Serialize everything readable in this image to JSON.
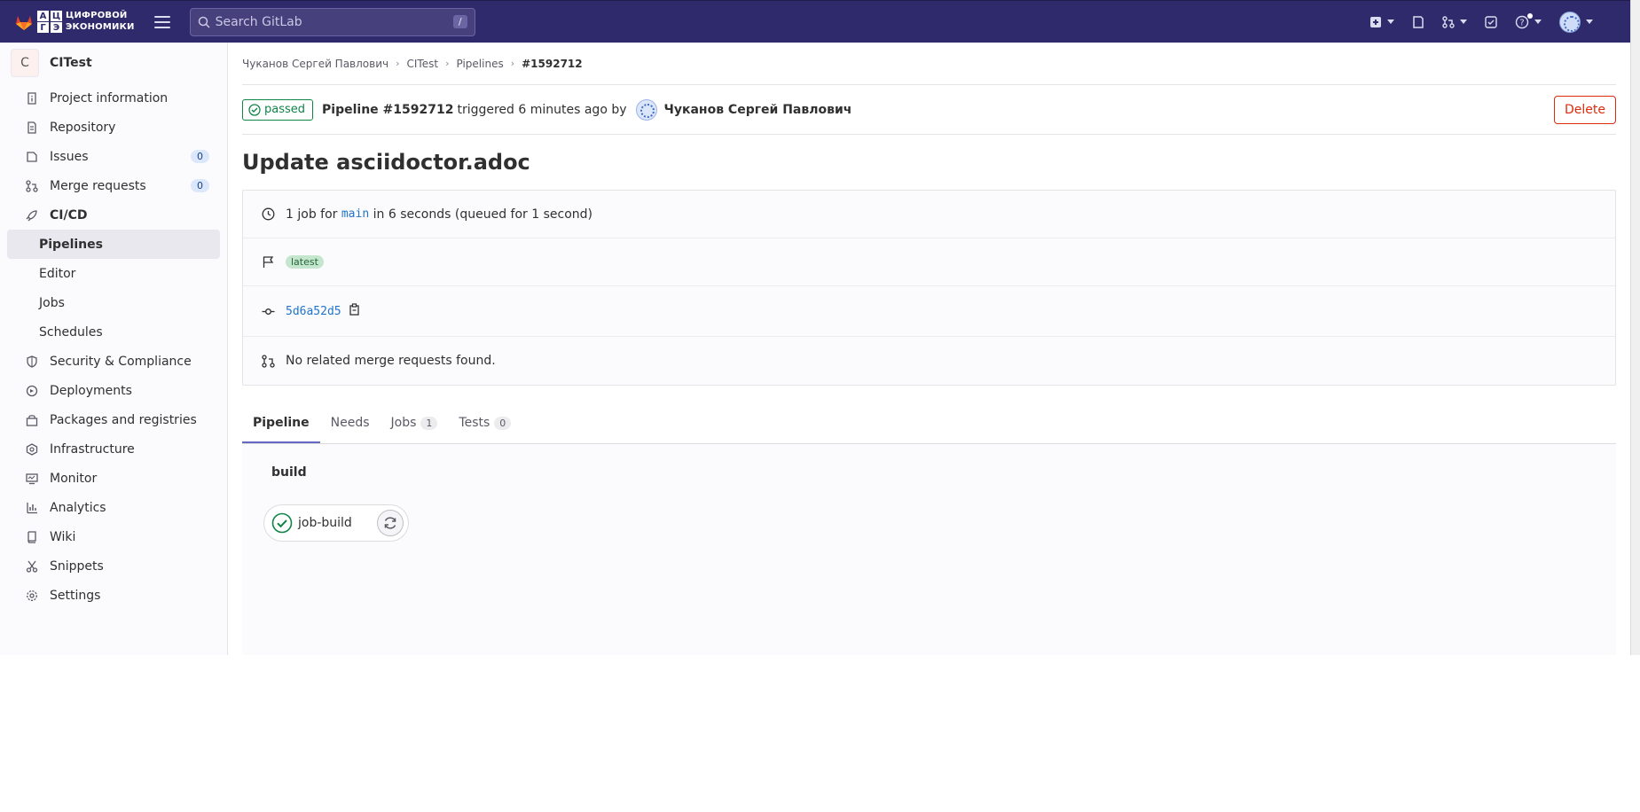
{
  "header": {
    "logo_letters": [
      "А",
      "Ц",
      "Г",
      "Э"
    ],
    "logo_line1": "ЦИФРОВОЙ",
    "logo_line2": "ЭКОНОМИКИ",
    "search_placeholder": "Search GitLab",
    "search_shortcut": "/",
    "icons": [
      "plus-square-icon",
      "issues-icon",
      "merge-request-icon",
      "todo-icon",
      "help-icon",
      "user-avatar"
    ]
  },
  "sidebar": {
    "project_initial": "C",
    "project_name": "CITest",
    "items": [
      {
        "label": "Project information",
        "icon": "info-icon"
      },
      {
        "label": "Repository",
        "icon": "doc-icon"
      },
      {
        "label": "Issues",
        "icon": "issues-icon",
        "count": "0"
      },
      {
        "label": "Merge requests",
        "icon": "merge-request-icon",
        "count": "0"
      },
      {
        "label": "CI/CD",
        "icon": "rocket-icon"
      },
      {
        "label": "Pipelines"
      },
      {
        "label": "Editor"
      },
      {
        "label": "Jobs"
      },
      {
        "label": "Schedules"
      },
      {
        "label": "Security & Compliance",
        "icon": "shield-icon"
      },
      {
        "label": "Deployments",
        "icon": "deployments-icon"
      },
      {
        "label": "Packages and registries",
        "icon": "package-icon"
      },
      {
        "label": "Infrastructure",
        "icon": "cloud-icon"
      },
      {
        "label": "Monitor",
        "icon": "monitor-icon"
      },
      {
        "label": "Analytics",
        "icon": "chart-icon"
      },
      {
        "label": "Wiki",
        "icon": "book-icon"
      },
      {
        "label": "Snippets",
        "icon": "snippet-icon"
      },
      {
        "label": "Settings",
        "icon": "gear-icon"
      }
    ]
  },
  "breadcrumbs": [
    "Чуканов Сергей Павлович",
    "CITest",
    "Pipelines",
    "#1592712"
  ],
  "pipeline": {
    "status": "passed",
    "label": "Pipeline #1592712",
    "triggered": "triggered 6 minutes ago by",
    "user": "Чуканов Сергей Павлович",
    "delete_label": "Delete",
    "title": "Update asciidoctor.adoc",
    "jobs_prefix": "1 job for",
    "branch": "main",
    "duration_text": "in 6 seconds (queued for 1 second)",
    "tag": "latest",
    "commit": "5d6a52d5",
    "mr_text": "No related merge requests found."
  },
  "tabs": [
    {
      "label": "Pipeline"
    },
    {
      "label": "Needs"
    },
    {
      "label": "Jobs",
      "count": "1"
    },
    {
      "label": "Tests",
      "count": "0"
    }
  ],
  "graph": {
    "stage": "build",
    "job_name": "job-build"
  },
  "colors": {
    "topbar": "#2f2a6b",
    "success": "#108548",
    "danger": "#dd2b0e",
    "link": "#1f75cb",
    "tab_active": "#6666c4"
  }
}
